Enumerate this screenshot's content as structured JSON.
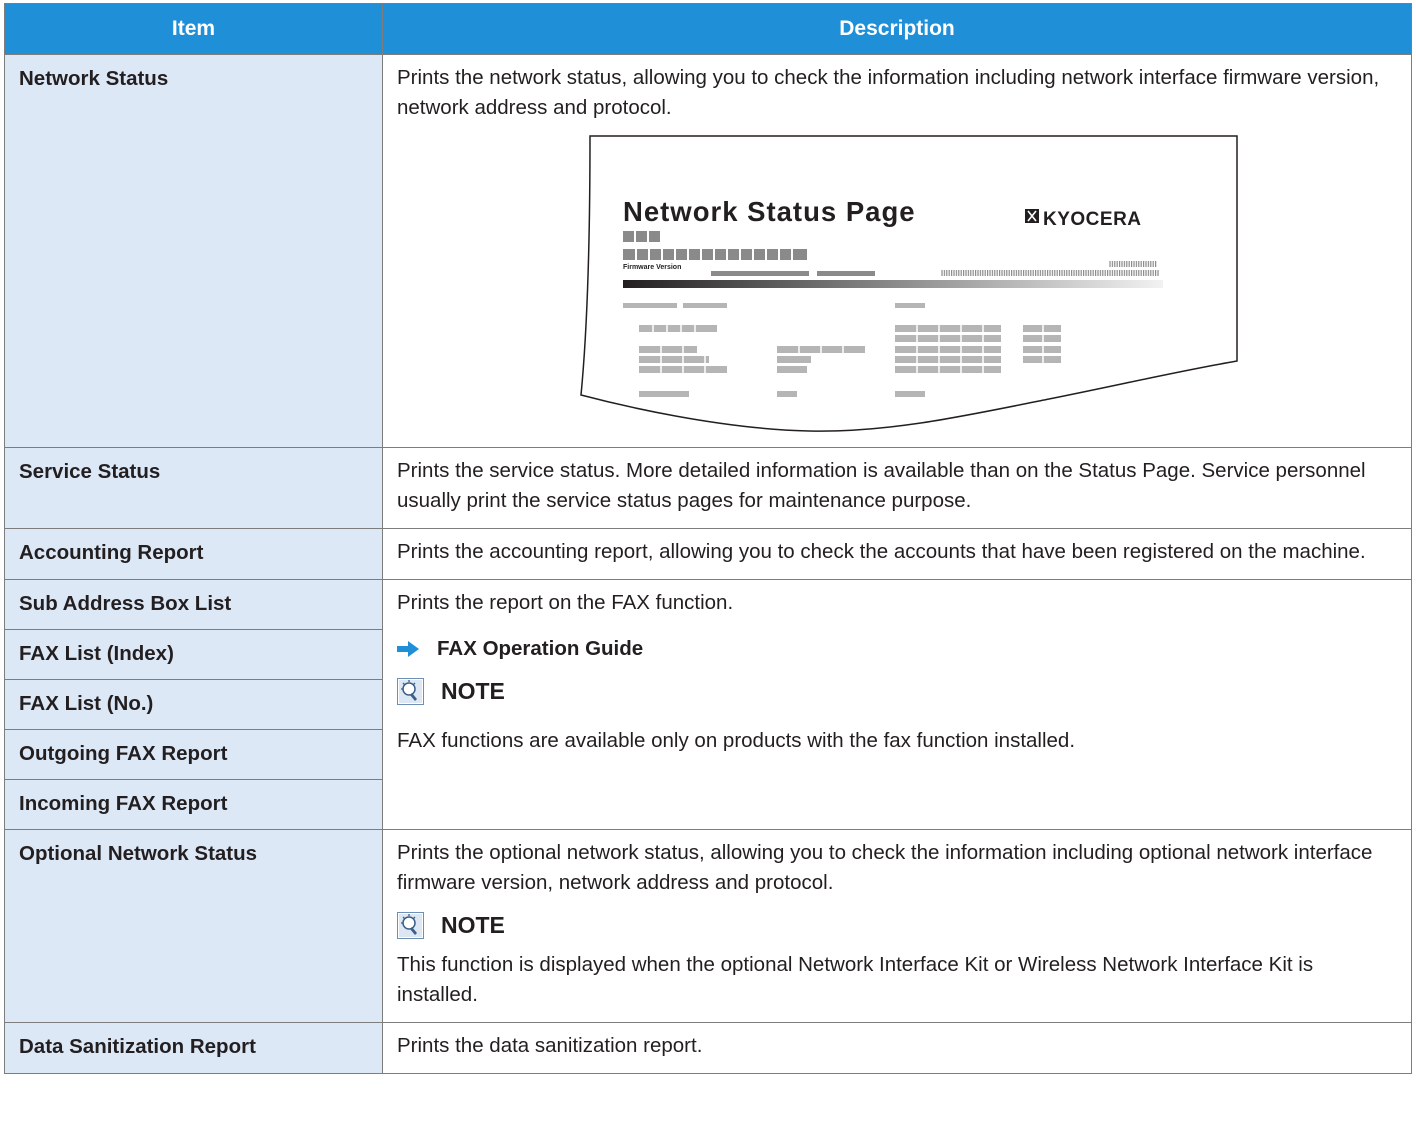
{
  "header": {
    "col_item": "Item",
    "col_description": "Description"
  },
  "network_status": {
    "item": "Network Status",
    "desc": "Prints the network status, allowing you to check the information including network interface firmware version, network address and protocol.",
    "illustration": {
      "title": "Network Status Page",
      "logo": "KYOCERA",
      "firmware_label": "Firmware Version"
    }
  },
  "service_status": {
    "item": "Service Status",
    "desc": "Prints the service status. More detailed information is available than on the Status Page. Service personnel usually print the service status pages for maintenance purpose."
  },
  "accounting_report": {
    "item": "Accounting Report",
    "desc": "Prints the accounting report, allowing you to check the accounts that have been registered on the machine."
  },
  "fax_group": {
    "items": [
      "Sub Address Box List",
      "FAX List (Index)",
      "FAX List (No.)",
      "Outgoing FAX Report",
      "Incoming FAX Report"
    ],
    "desc": "Prints the report on the FAX function.",
    "ref": "FAX Operation Guide",
    "note_label": "NOTE",
    "note_text": "FAX functions are available only on products with the fax function installed."
  },
  "optional_network_status": {
    "item": "Optional Network Status",
    "desc": "Prints the optional network status, allowing you to check the information including optional network interface firmware version, network address and protocol.",
    "note_label": "NOTE",
    "note_text": "This function is displayed when the optional Network Interface Kit or Wireless Network Interface Kit is installed."
  },
  "data_sanitization_report": {
    "item": "Data Sanitization Report",
    "desc": "Prints the data sanitization report."
  },
  "colors": {
    "header_bg": "#1f90d8",
    "item_bg": "#dde8f7",
    "border": "#7d7d7d",
    "arrow": "#1f90d8"
  }
}
